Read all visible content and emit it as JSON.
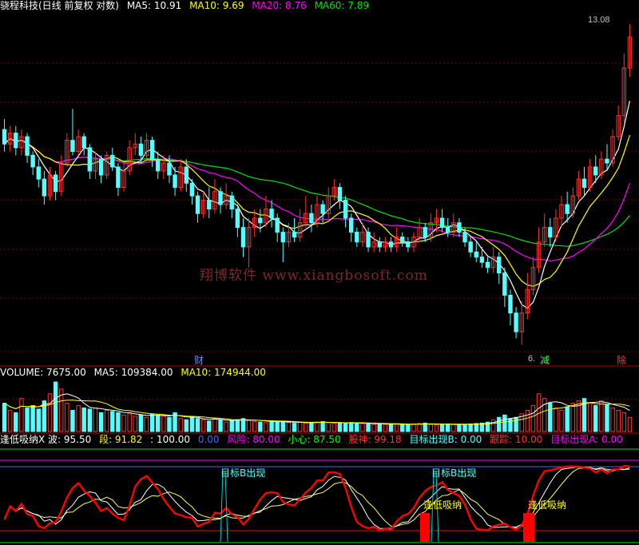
{
  "colors": {
    "bg": "#000000",
    "grid": "#7a0000",
    "up": "#ff3232",
    "down": "#54ffff",
    "ma5": "#ffffff",
    "ma10": "#ffff00",
    "ma20": "#ff00ff",
    "ma60": "#00e000",
    "ind_main": "#ff0000",
    "ind_white": "#ffffff",
    "ind_yellow": "#ffff66",
    "ind_cyan": "#00cccc"
  },
  "price_header": {
    "title": "骁程科技(日线 前复权 对数)",
    "ma5": "MA5: 10.91",
    "ma10": "MA10: 9.69",
    "ma20": "MA20: 8.76",
    "ma60": "MA60: 7.89"
  },
  "price_panel": {
    "high_label": "13.08",
    "low_label": "6.",
    "markers": {
      "cai_left": "财",
      "cai_mid": "减",
      "cai_right": "除"
    },
    "watermark": "翔博软件 www.xiangbosoft.com"
  },
  "volume_header": {
    "volume": "VOLUME: 7675.00",
    "ma5": "MA5: 109384.00",
    "ma10": "MA10: 174944.00"
  },
  "indicator_header": {
    "name": "逢低吸纳X 波: 95.50",
    "duan": "段: 91.82",
    "hundred": ": 100.00",
    "zero": "0.00",
    "fengxian": "风险: 80.00",
    "xiaoxin": "小心: 87.50",
    "gushen": "股神: 99.18",
    "mubiao_b": "目标出现B: 0.00",
    "genzong": "跟踪: 10.00",
    "mubiao_a": "目标出现A: 0.00"
  },
  "indicator_labels": {
    "mubiao_b_1": "目标B出现",
    "mubiao_b_2": "目标B出现",
    "fengdi_1": "逢低吸纳",
    "fengdi_2": "逢低吸纳"
  },
  "chart_data": {
    "type": "candlestick",
    "price_axis_scale": "log",
    "visible_labels": {
      "high": 13.08,
      "low_prefix": "6."
    },
    "ma_values_last": {
      "MA5": 10.91,
      "MA10": 9.69,
      "MA20": 8.76,
      "MA60": 7.89
    },
    "candles": [
      [
        9.6,
        9.2,
        9.9,
        9.0
      ],
      [
        9.2,
        9.5,
        9.7,
        9.0
      ],
      [
        9.5,
        9.1,
        9.7,
        8.9
      ],
      [
        9.1,
        9.4,
        9.6,
        8.9
      ],
      [
        9.4,
        8.9,
        9.5,
        8.7
      ],
      [
        8.9,
        8.6,
        9.0,
        8.4
      ],
      [
        8.6,
        8.3,
        8.8,
        8.1
      ],
      [
        8.3,
        7.9,
        8.5,
        7.7
      ],
      [
        7.9,
        8.4,
        8.6,
        7.8
      ],
      [
        8.4,
        8.0,
        8.5,
        7.8
      ],
      [
        8.0,
        8.7,
        8.9,
        7.9
      ],
      [
        8.7,
        9.3,
        9.5,
        8.6
      ],
      [
        9.3,
        9.0,
        10.2,
        8.9
      ],
      [
        9.0,
        9.4,
        9.6,
        8.9
      ],
      [
        9.4,
        9.1,
        9.5,
        8.9
      ],
      [
        9.1,
        8.5,
        9.2,
        8.3
      ],
      [
        8.5,
        8.8,
        9.0,
        8.3
      ],
      [
        8.8,
        8.4,
        8.9,
        8.2
      ],
      [
        8.4,
        8.9,
        9.0,
        8.3
      ],
      [
        8.9,
        8.6,
        9.1,
        8.5
      ],
      [
        8.6,
        8.1,
        8.7,
        7.9
      ],
      [
        8.1,
        8.5,
        8.7,
        8.0
      ],
      [
        8.5,
        9.1,
        9.3,
        8.4
      ],
      [
        9.1,
        9.2,
        9.5,
        8.9
      ],
      [
        9.2,
        8.9,
        9.4,
        8.7
      ],
      [
        8.9,
        9.3,
        9.5,
        8.8
      ],
      [
        9.3,
        8.8,
        9.4,
        8.6
      ],
      [
        8.8,
        8.5,
        9.0,
        8.3
      ],
      [
        8.5,
        8.7,
        8.9,
        8.3
      ],
      [
        8.7,
        8.4,
        8.9,
        8.2
      ],
      [
        8.4,
        8.1,
        8.6,
        7.9
      ],
      [
        8.1,
        8.6,
        8.8,
        8.0
      ],
      [
        8.6,
        8.2,
        8.8,
        8.0
      ],
      [
        8.2,
        7.9,
        8.3,
        7.7
      ],
      [
        7.9,
        7.5,
        8.0,
        7.3
      ],
      [
        7.5,
        7.8,
        8.0,
        7.4
      ],
      [
        7.8,
        7.6,
        8.1,
        7.4
      ],
      [
        7.6,
        8.0,
        8.3,
        7.5
      ],
      [
        8.0,
        7.7,
        8.1,
        7.5
      ],
      [
        7.7,
        7.9,
        8.2,
        7.6
      ],
      [
        7.9,
        7.6,
        8.0,
        7.4
      ],
      [
        7.6,
        7.2,
        7.7,
        7.0
      ],
      [
        7.2,
        6.8,
        7.4,
        6.6
      ],
      [
        6.8,
        7.2,
        7.4,
        6.4
      ],
      [
        7.2,
        7.4,
        7.6,
        7.0
      ],
      [
        7.4,
        7.3,
        7.6,
        7.1
      ],
      [
        7.3,
        7.6,
        7.9,
        7.2
      ],
      [
        7.6,
        7.4,
        7.8,
        7.2
      ],
      [
        7.4,
        7.1,
        7.5,
        6.9
      ],
      [
        7.1,
        6.9,
        7.2,
        6.5
      ],
      [
        6.9,
        7.1,
        7.3,
        6.8
      ],
      [
        7.1,
        7.0,
        7.4,
        6.9
      ],
      [
        7.0,
        7.3,
        7.6,
        6.9
      ],
      [
        7.3,
        7.5,
        7.9,
        7.2
      ],
      [
        7.5,
        7.3,
        7.7,
        7.1
      ],
      [
        7.3,
        7.7,
        7.9,
        7.2
      ],
      [
        7.7,
        7.5,
        7.8,
        7.3
      ],
      [
        7.5,
        7.9,
        8.1,
        7.4
      ],
      [
        7.9,
        8.1,
        8.3,
        7.8
      ],
      [
        8.1,
        7.8,
        8.2,
        7.6
      ],
      [
        7.8,
        7.4,
        7.9,
        7.2
      ],
      [
        7.4,
        7.1,
        7.5,
        6.9
      ],
      [
        7.1,
        6.9,
        7.2,
        6.8
      ],
      [
        6.9,
        7.1,
        7.3,
        6.8
      ],
      [
        7.1,
        6.8,
        7.2,
        6.7
      ],
      [
        6.8,
        6.9,
        7.1,
        6.7
      ],
      [
        6.9,
        6.8,
        7.0,
        6.7
      ],
      [
        6.8,
        6.9,
        7.0,
        6.7
      ],
      [
        6.9,
        6.8,
        7.0,
        6.7
      ],
      [
        6.8,
        7.0,
        7.2,
        6.7
      ],
      [
        7.0,
        6.9,
        7.1,
        6.8
      ],
      [
        6.9,
        6.8,
        7.0,
        6.7
      ],
      [
        6.8,
        7.0,
        7.1,
        6.7
      ],
      [
        7.0,
        7.2,
        7.4,
        6.9
      ],
      [
        7.2,
        7.0,
        7.3,
        6.9
      ],
      [
        7.0,
        7.3,
        7.5,
        6.9
      ],
      [
        7.3,
        7.4,
        7.6,
        7.1
      ],
      [
        7.4,
        7.2,
        7.6,
        7.1
      ],
      [
        7.2,
        7.1,
        7.4,
        7.0
      ],
      [
        7.1,
        7.3,
        7.5,
        7.0
      ],
      [
        7.3,
        7.1,
        7.4,
        7.0
      ],
      [
        7.1,
        6.9,
        7.2,
        6.8
      ],
      [
        6.9,
        6.7,
        7.0,
        6.6
      ],
      [
        6.7,
        6.6,
        6.9,
        6.5
      ],
      [
        6.6,
        6.5,
        6.8,
        6.4
      ],
      [
        6.5,
        6.4,
        6.6,
        6.3
      ],
      [
        6.4,
        6.6,
        6.8,
        6.3
      ],
      [
        6.6,
        6.3,
        6.7,
        6.1
      ],
      [
        6.3,
        5.9,
        6.4,
        5.7
      ],
      [
        5.9,
        5.6,
        6.0,
        5.4
      ],
      [
        5.6,
        5.3,
        5.7,
        5.2
      ],
      [
        5.3,
        5.6,
        5.8,
        5.1
      ],
      [
        5.6,
        6.0,
        6.3,
        5.5
      ],
      [
        6.0,
        6.4,
        6.6,
        5.9
      ],
      [
        6.4,
        6.9,
        7.2,
        6.3
      ],
      [
        6.9,
        7.2,
        7.5,
        6.8
      ],
      [
        7.2,
        7.0,
        7.4,
        6.8
      ],
      [
        7.0,
        7.4,
        7.6,
        6.9
      ],
      [
        7.4,
        7.7,
        7.9,
        7.2
      ],
      [
        7.7,
        7.5,
        8.0,
        7.3
      ],
      [
        7.5,
        7.9,
        8.1,
        7.4
      ],
      [
        7.9,
        8.3,
        8.5,
        7.8
      ],
      [
        8.3,
        8.1,
        8.6,
        7.9
      ],
      [
        8.1,
        8.6,
        8.8,
        8.0
      ],
      [
        8.6,
        8.4,
        8.9,
        8.2
      ],
      [
        8.4,
        8.8,
        9.0,
        8.3
      ],
      [
        8.8,
        8.7,
        9.2,
        8.5
      ],
      [
        8.7,
        9.4,
        9.6,
        8.6
      ],
      [
        9.4,
        10.0,
        10.3,
        9.3
      ],
      [
        10.0,
        11.5,
        12.0,
        9.8
      ],
      [
        11.5,
        12.6,
        13.08,
        11.2
      ]
    ],
    "volume": [
      120,
      90,
      80,
      140,
      100,
      110,
      95,
      130,
      160,
      210,
      180,
      120,
      90,
      110,
      100,
      95,
      100,
      80,
      90,
      85,
      80,
      70,
      75,
      65,
      70,
      60,
      75,
      70,
      65,
      60,
      80,
      55,
      50,
      60,
      55,
      50,
      45,
      55,
      50,
      40,
      45,
      50,
      55,
      48,
      42,
      40,
      38,
      45,
      42,
      40,
      38,
      35,
      40,
      36,
      38,
      40,
      42,
      38,
      35,
      36,
      34,
      38,
      36,
      34,
      32,
      30,
      33,
      31,
      30,
      32,
      28,
      30,
      32,
      34,
      36,
      30,
      28,
      30,
      32,
      30,
      28,
      30,
      32,
      34,
      36,
      40,
      50,
      60,
      70,
      55,
      60,
      75,
      90,
      110,
      160,
      140,
      120,
      100,
      90,
      105,
      120,
      130,
      140,
      120,
      110,
      130,
      115,
      100,
      90,
      80,
      60
    ],
    "indicator": {
      "bo": 95.5,
      "duan": 91.82,
      "upper": 100.0,
      "lower": 0.0,
      "fengxian": 80.0,
      "xiaoxin": 87.5,
      "gushen": 99.18,
      "mubiao_b": 0.0,
      "genzong": 10.0,
      "mubiao_a": 0.0
    }
  }
}
